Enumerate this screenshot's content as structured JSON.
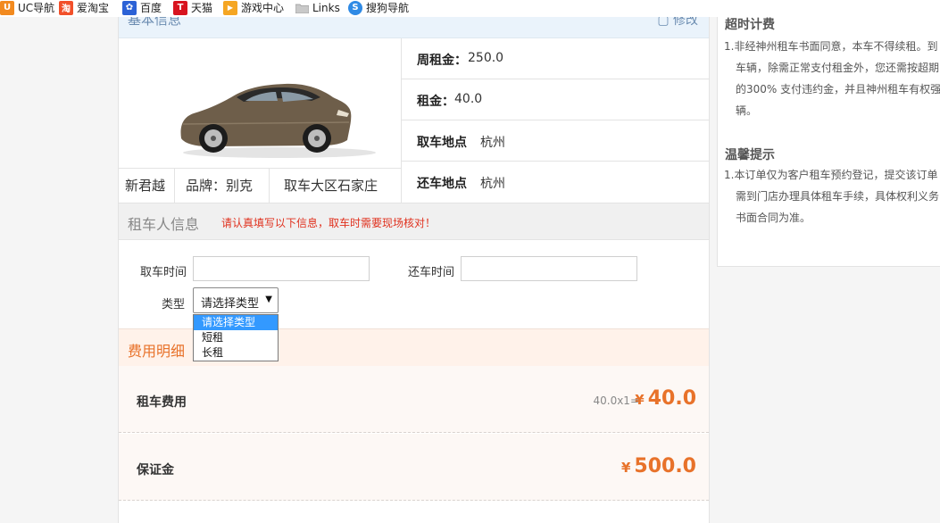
{
  "bookmarks": [
    {
      "label": "UC导航",
      "icon": "uc-nav-icon",
      "glyph": "U",
      "color": "#f28a1f"
    },
    {
      "label": "爱淘宝",
      "icon": "ai-taobao-icon",
      "glyph": "淘",
      "color": "#f2502a"
    },
    {
      "label": "百度",
      "icon": "baidu-paw-icon",
      "glyph": "✿",
      "color": "#2c62d6"
    },
    {
      "label": "天猫",
      "icon": "tmall-icon",
      "glyph": "T",
      "color": "#d8141f"
    },
    {
      "label": "游戏中心",
      "icon": "game-center-icon",
      "glyph": "▶",
      "color": "#f5a623"
    },
    {
      "label": "Links",
      "icon": "folder-icon",
      "glyph": "",
      "color": "#c9c9c9"
    },
    {
      "label": "搜狗导航",
      "icon": "sogou-icon",
      "glyph": "S",
      "color": "#2f8ae5"
    }
  ],
  "basic_info": {
    "title": "基本信息",
    "edit_label": "修改",
    "car_name": "新君越",
    "brand": "品牌：别克",
    "pickup_region": "取车大区石家庄",
    "rows": [
      {
        "label": "周租金：",
        "value": "250.0"
      },
      {
        "label": "租金：",
        "value": "40.0"
      },
      {
        "label": "取车地点",
        "value": "杭州"
      },
      {
        "label": "还车地点",
        "value": "杭州"
      }
    ]
  },
  "renter": {
    "title": "租车人信息",
    "note": "请认真填写以下信息，取车时需要现场核对！",
    "pickup_time_label": "取车时间",
    "return_time_label": "还车时间",
    "pickup_time_value": "",
    "return_time_value": "",
    "type_label": "类型",
    "type_selected": "请选择类型",
    "type_options": [
      "请选择类型",
      "短租",
      "长租"
    ]
  },
  "fees": {
    "title": "费用明细",
    "currency": "¥",
    "rows": [
      {
        "label": "租车费用",
        "calc": "40.0x1=",
        "amount": "40.0"
      },
      {
        "label": "保证金",
        "calc": "",
        "amount": "500.0"
      }
    ]
  },
  "sidebar": {
    "overtime_title": "超时计费",
    "overtime_lines": [
      "1.非经神州租车书面同意，本车不得续租。到",
      "车辆，除需正常支付租金外，您还需按超期",
      "的300%  支付违约金，并且神州租车有权强",
      "辆。"
    ],
    "tips_title": "温馨提示",
    "tips_lines": [
      "1.本订单仅为客户租车预约登记，提交该订单",
      "需到门店办理具体租车手续，具体权利义务",
      "书面合同为准。"
    ]
  },
  "colors": {
    "accent_orange": "#e8722a",
    "note_red": "#e0311e",
    "select_blue": "#3399ff"
  }
}
